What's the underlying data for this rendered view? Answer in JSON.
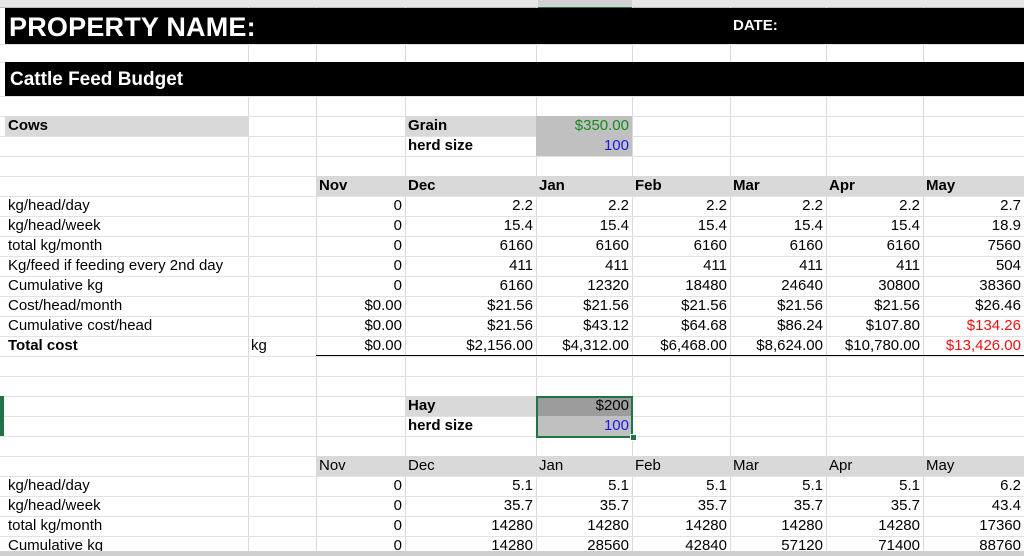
{
  "title": {
    "property_label": "PROPERTY NAME:",
    "date_label": "DATE:",
    "budget_title": "Cattle Feed Budget"
  },
  "grain": {
    "category": "Cows",
    "label": "Grain",
    "price": "$350.00",
    "herd_label": "herd size",
    "herd_size": "100"
  },
  "months": [
    "Nov",
    "Dec",
    "Jan",
    "Feb",
    "Mar",
    "Apr",
    "May"
  ],
  "grain_rows": [
    {
      "label": "kg/head/day",
      "unit": "",
      "bold": false,
      "values": [
        "0",
        "2.2",
        "2.2",
        "2.2",
        "2.2",
        "2.2",
        "2.7"
      ],
      "red": []
    },
    {
      "label": "kg/head/week",
      "unit": "",
      "bold": false,
      "values": [
        "0",
        "15.4",
        "15.4",
        "15.4",
        "15.4",
        "15.4",
        "18.9"
      ],
      "red": []
    },
    {
      "label": "total kg/month",
      "unit": "",
      "bold": false,
      "values": [
        "0",
        "6160",
        "6160",
        "6160",
        "6160",
        "6160",
        "7560"
      ],
      "red": []
    },
    {
      "label": "Kg/feed if feeding every 2nd day",
      "unit": "",
      "bold": false,
      "values": [
        "0",
        "411",
        "411",
        "411",
        "411",
        "411",
        "504"
      ],
      "red": []
    },
    {
      "label": "Cumulative kg",
      "unit": "",
      "bold": false,
      "values": [
        "0",
        "6160",
        "12320",
        "18480",
        "24640",
        "30800",
        "38360"
      ],
      "red": []
    },
    {
      "label": "Cost/head/month",
      "unit": "",
      "bold": false,
      "values": [
        "$0.00",
        "$21.56",
        "$21.56",
        "$21.56",
        "$21.56",
        "$21.56",
        "$26.46"
      ],
      "red": []
    },
    {
      "label": "Cumulative cost/head",
      "unit": "",
      "bold": false,
      "values": [
        "$0.00",
        "$21.56",
        "$43.12",
        "$64.68",
        "$86.24",
        "$107.80",
        "$134.26"
      ],
      "red": [
        6
      ]
    },
    {
      "label": "Total cost",
      "unit": "kg",
      "bold": true,
      "values": [
        "$0.00",
        "$2,156.00",
        "$4,312.00",
        "$6,468.00",
        "$8,624.00",
        "$10,780.00",
        "$13,426.00"
      ],
      "red": [
        6
      ]
    }
  ],
  "hay": {
    "label": "Hay",
    "price": "$200",
    "herd_label": "herd size",
    "herd_size": "100"
  },
  "hay_rows": [
    {
      "label": "kg/head/day",
      "values": [
        "0",
        "5.1",
        "5.1",
        "5.1",
        "5.1",
        "5.1",
        "6.2"
      ]
    },
    {
      "label": "kg/head/week",
      "values": [
        "0",
        "35.7",
        "35.7",
        "35.7",
        "35.7",
        "35.7",
        "43.4"
      ]
    },
    {
      "label": "total kg/month",
      "values": [
        "0",
        "14280",
        "14280",
        "14280",
        "14280",
        "14280",
        "17360"
      ]
    },
    {
      "label": "Cumulative kg",
      "values": [
        "0",
        "14280",
        "28560",
        "42840",
        "57120",
        "71400",
        "88760"
      ]
    }
  ],
  "colors": {
    "green": "#138a1b",
    "blue": "#1a1aee",
    "red": "#ee1111",
    "selection": "#217346",
    "header_fill": "#d9d9d9",
    "title_bar": "#000000"
  }
}
